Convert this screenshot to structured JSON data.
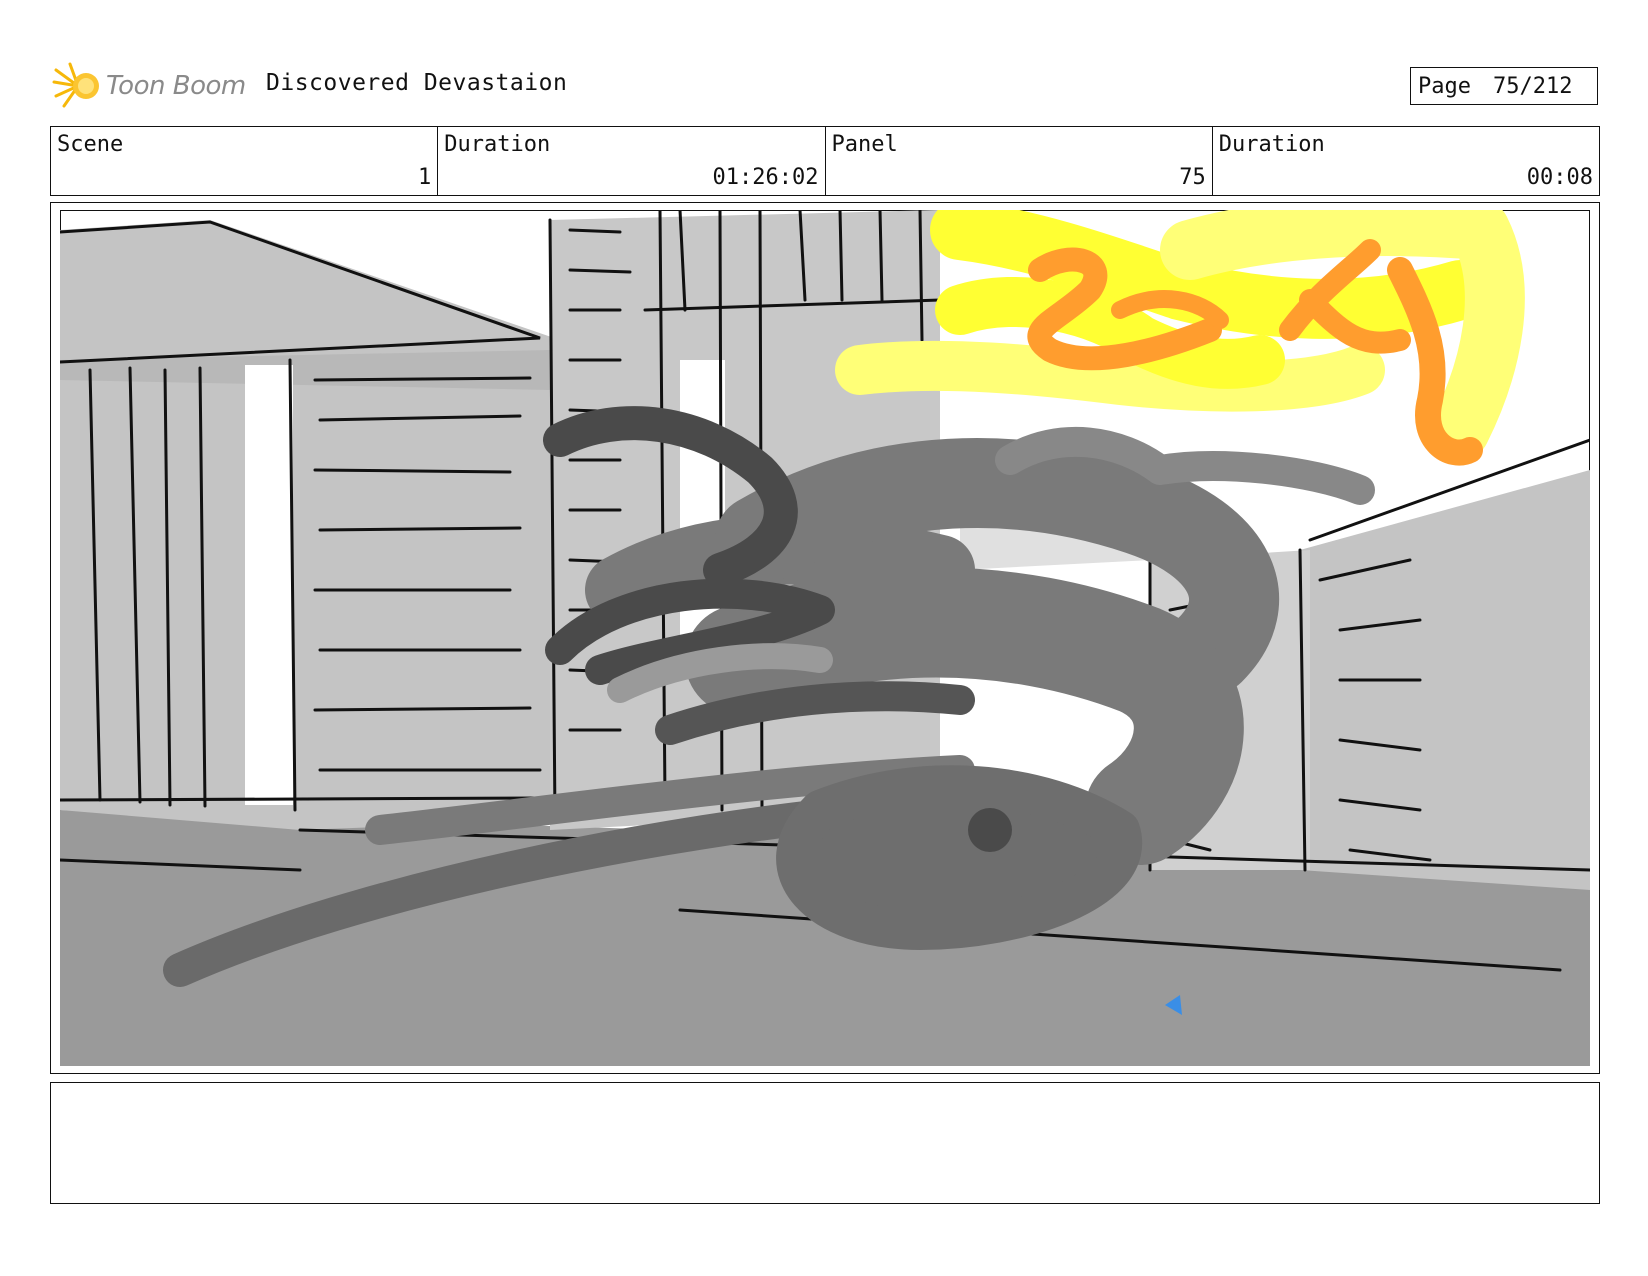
{
  "header": {
    "logo_text": "Toon Boom",
    "project_title": "Discovered Devastaion",
    "page_label": "Page",
    "page_value": "75/212"
  },
  "info": {
    "scene_label": "Scene",
    "scene_value": "1",
    "scene_duration_label": "Duration",
    "scene_duration_value": "01:26:02",
    "panel_label": "Panel",
    "panel_value": "75",
    "panel_duration_label": "Duration",
    "panel_duration_value": "00:08"
  },
  "notes": {
    "text": ""
  },
  "colors": {
    "sky": "#ffffff",
    "buildings": "#c4c4c4",
    "street": "#9a9a9a",
    "smoke_dark": "#4a4a4a",
    "smoke_mid": "#7a7a7a",
    "fire_yellow": "#ffff33",
    "fire_light": "#ffff77",
    "fire_orange": "#ff9d2e"
  }
}
